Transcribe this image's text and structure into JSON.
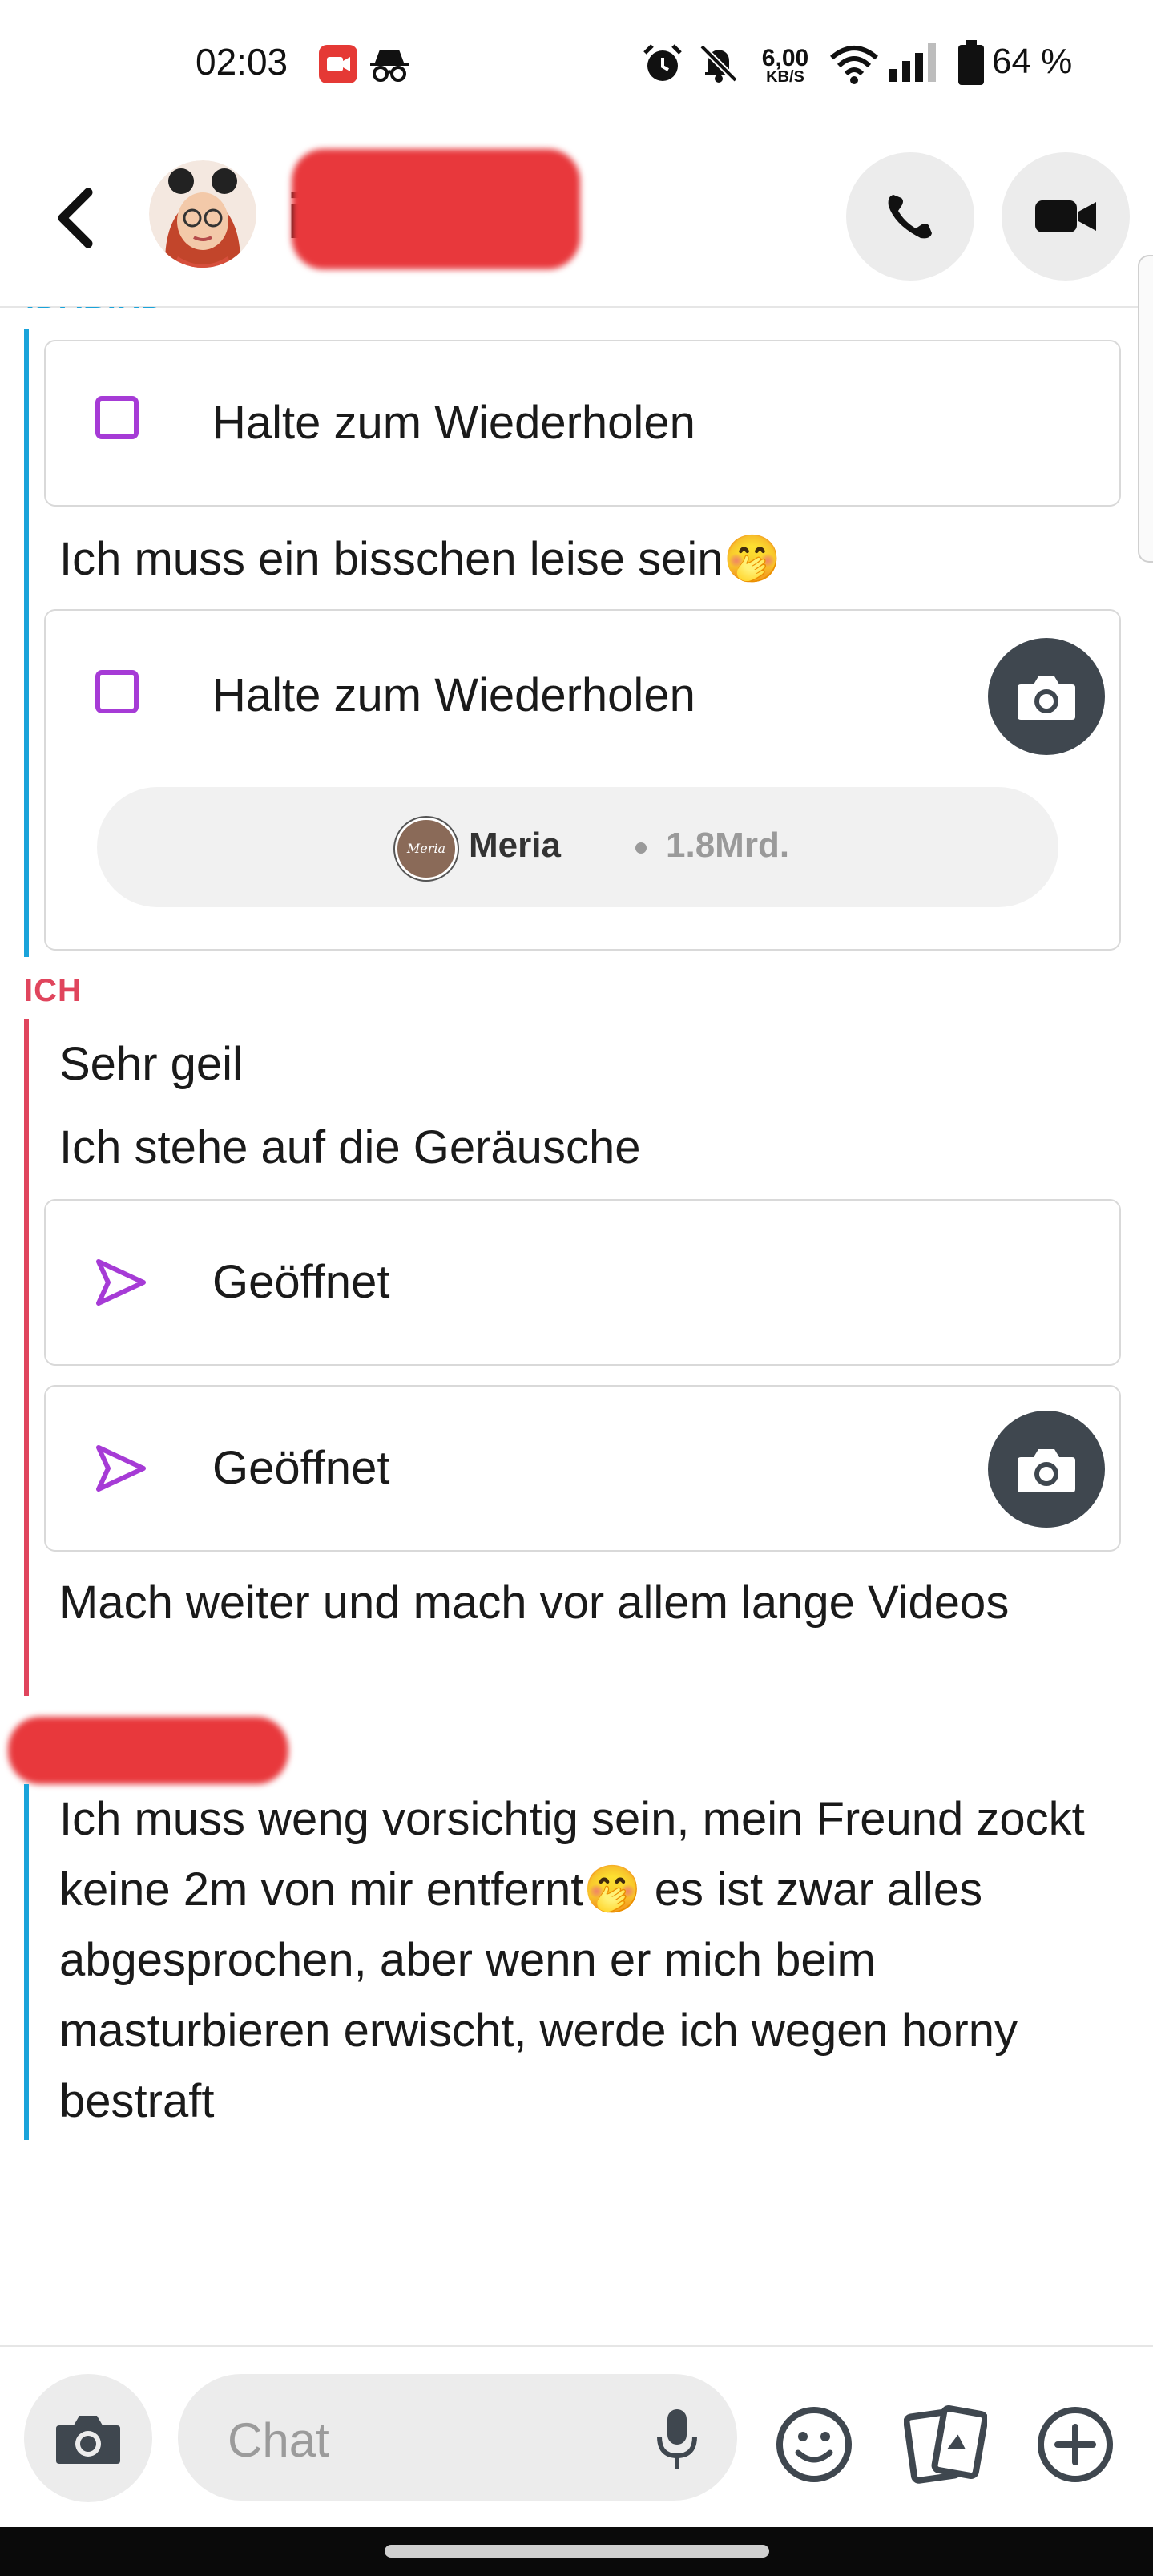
{
  "status": {
    "time": "02:03",
    "net_speed_value": "6,00",
    "net_speed_unit": "KB/S",
    "battery": "64 %",
    "icons": [
      "screen-record-icon",
      "incognito-icon",
      "alarm-icon",
      "mute-bell-icon",
      "wifi-icon",
      "signal-icon",
      "battery-icon"
    ]
  },
  "header": {
    "contact_initial": "i",
    "icons": [
      "back-arrow-icon",
      "avatar",
      "phone-icon",
      "video-camera-icon"
    ]
  },
  "chat": {
    "sender_top_partial": "IDABIRD",
    "snap_1_label": "Halte zum Wiederholen",
    "text_1": "Ich muss ein bisschen leise sein🤭",
    "snap_2_label": "Halte zum Wiederholen",
    "lens_creator": "Meria",
    "lens_views": "1.8Mrd.",
    "lens_avatar_text": "Meria",
    "sender_me": "ICH",
    "text_2": "Sehr geil",
    "text_3": "Ich stehe auf die Geräusche",
    "sent_1_label": "Geöffnet",
    "sent_2_label": "Geöffnet",
    "text_4": "Mach weiter und mach vor allem lange Videos",
    "text_5": "Ich muss weng vorsichtig sein, mein Freund zockt keine 2m von mir entfernt🤭 es ist zwar alles abgesprochen, aber wenn er mich beim masturbieren erwischt, werde ich wegen horny bestraft"
  },
  "composer": {
    "placeholder": "Chat",
    "icons": [
      "camera-icon",
      "microphone-icon",
      "emoji-icon",
      "stickers-icon",
      "plus-icon"
    ]
  },
  "colors": {
    "friend_accent": "#1aa3da",
    "me_accent": "#e0455d",
    "snap_purple": "#a63bd6",
    "redaction": "#e8383c"
  }
}
